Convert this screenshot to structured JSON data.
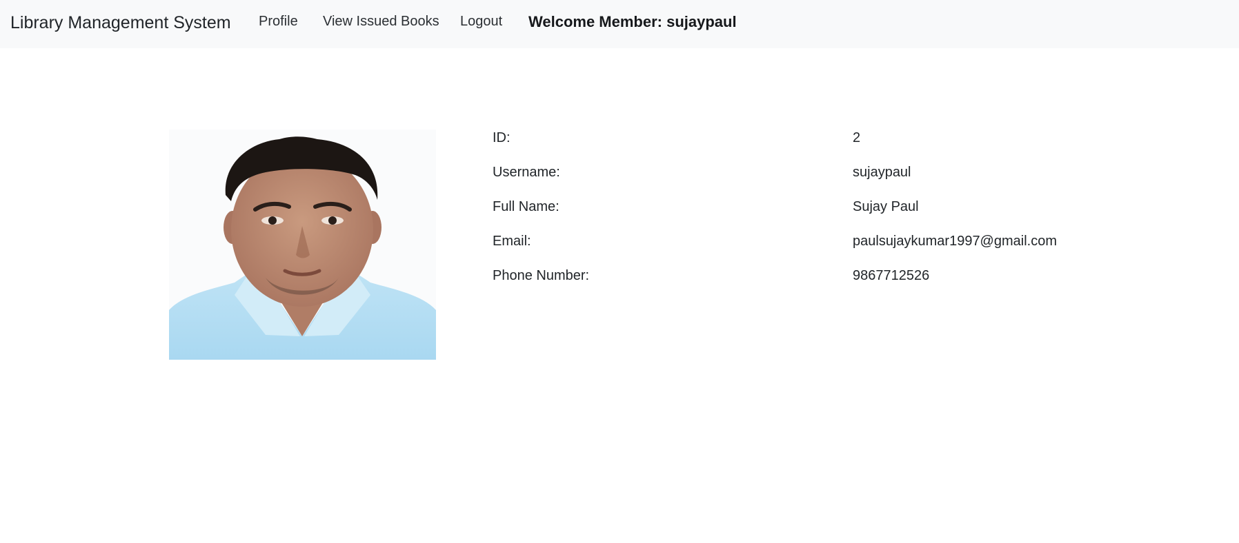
{
  "navbar": {
    "brand": "Library Management System",
    "links": [
      {
        "label": "Profile"
      },
      {
        "label": "View Issued Books"
      },
      {
        "label": "Logout"
      }
    ],
    "welcome": "Welcome Member: sujaypaul"
  },
  "profile": {
    "photo_icon": "avatar",
    "fields": [
      {
        "label": "ID:",
        "value": "2"
      },
      {
        "label": "Username:",
        "value": "sujaypaul"
      },
      {
        "label": "Full Name:",
        "value": "Sujay Paul"
      },
      {
        "label": "Email:",
        "value": "paulsujaykumar1997@gmail.com"
      },
      {
        "label": "Phone Number:",
        "value": "9867712526"
      }
    ]
  }
}
